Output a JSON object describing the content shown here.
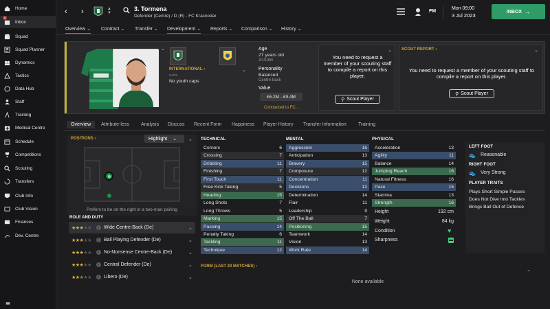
{
  "sidebar": {
    "items": [
      {
        "label": "Home",
        "icon": "home-icon"
      },
      {
        "label": "Inbox",
        "icon": "inbox-icon",
        "badge": "1"
      },
      {
        "label": "Squad",
        "icon": "squad-icon"
      },
      {
        "label": "Squad Planner",
        "icon": "planner-icon"
      },
      {
        "label": "Dynamics",
        "icon": "dynamics-icon"
      },
      {
        "label": "Tactics",
        "icon": "tactics-icon"
      },
      {
        "label": "Data Hub",
        "icon": "datahub-icon"
      },
      {
        "label": "Staff",
        "icon": "staff-icon"
      },
      {
        "label": "Training",
        "icon": "training-icon"
      },
      {
        "label": "Medical Centre",
        "icon": "medical-icon"
      },
      {
        "label": "Schedule",
        "icon": "schedule-icon"
      },
      {
        "label": "Competitions",
        "icon": "competitions-icon"
      },
      {
        "label": "Scouting",
        "icon": "scouting-icon"
      },
      {
        "label": "Transfers",
        "icon": "transfers-icon"
      },
      {
        "label": "Club Info",
        "icon": "clubinfo-icon"
      },
      {
        "label": "Club Vision",
        "icon": "clubvision-icon"
      },
      {
        "label": "Finances",
        "icon": "finances-icon"
      },
      {
        "label": "Dev. Centre",
        "icon": "devcentre-icon"
      }
    ]
  },
  "topbar": {
    "player_number_name": "3. Tormena",
    "player_subtitle": "Defender (Centre) / D (R) - FC Krasnodar",
    "day_time": "Mon 09:00",
    "date": "3 Jul 2023",
    "fm_label": "FM",
    "inbox_label": "INBOX"
  },
  "subnav": [
    "Overview",
    "Contract",
    "Transfer",
    "Development",
    "Reports",
    "Comparison",
    "History"
  ],
  "header": {
    "international_label": "INTERNATIONAL",
    "caps_label": "CAPS",
    "caps_value": "No youth caps",
    "age_label": "Age",
    "age_value": "27 years old",
    "dob": "4/1/1996",
    "personality_label": "Personality",
    "personality_value": "Balanced",
    "position_value": "Centre-back",
    "value_label": "Value",
    "value_range": "£6.2M - £9.4M",
    "contract_text": "Contracted to FC...",
    "scout_request_mid": "You need to request a member of your scouting staff to compile a report on this player.",
    "scout_button": "Scout Player",
    "scout_report_title": "SCOUT REPORT",
    "scout_request_right": "You need to request a member of your scouting staff to compile a report on this player.",
    "scout_button_right": "Scout Player"
  },
  "tabs": [
    "Overview",
    "Attribute-less",
    "Analysis",
    "Discuss",
    "Recent Form",
    "Happiness",
    "Player History",
    "Transfer Information",
    "Training"
  ],
  "positions": {
    "title": "POSITIONS",
    "highlight_label": "Highlight",
    "note": "Prefers to be on the right in a two-man pairing"
  },
  "roles": {
    "title": "ROLE AND DUTY",
    "items": [
      {
        "name": "Wide Centre-Back (De)",
        "stars": 3
      },
      {
        "name": "Ball Playing Defender (De)",
        "stars": 3
      },
      {
        "name": "No-Nonsense Centre-Back (De)",
        "stars": 3
      },
      {
        "name": "Central Defender (De)",
        "stars": 3
      },
      {
        "name": "Libero (De)",
        "stars": 2.5
      }
    ]
  },
  "technical": {
    "title": "TECHNICAL",
    "rows": [
      {
        "n": "Corners",
        "v": "6",
        "c": "none"
      },
      {
        "n": "Crossing",
        "v": "7",
        "c": "grey"
      },
      {
        "n": "Dribbling",
        "v": "11",
        "c": "blue"
      },
      {
        "n": "Finishing",
        "v": "7",
        "c": "grey"
      },
      {
        "n": "First Touch",
        "v": "11",
        "c": "blue"
      },
      {
        "n": "Free Kick Taking",
        "v": "5",
        "c": "grey"
      },
      {
        "n": "Heading",
        "v": "15",
        "c": "green"
      },
      {
        "n": "Long Shots",
        "v": "7",
        "c": "none"
      },
      {
        "n": "Long Throws",
        "v": "5",
        "c": "none"
      },
      {
        "n": "Marking",
        "v": "15",
        "c": "green"
      },
      {
        "n": "Passing",
        "v": "14",
        "c": "blue"
      },
      {
        "n": "Penalty Taking",
        "v": "6",
        "c": "none"
      },
      {
        "n": "Tackling",
        "v": "11",
        "c": "green"
      },
      {
        "n": "Technique",
        "v": "12",
        "c": "blue"
      }
    ]
  },
  "mental": {
    "title": "MENTAL",
    "rows": [
      {
        "n": "Aggression",
        "v": "16",
        "c": "blue"
      },
      {
        "n": "Anticipation",
        "v": "13",
        "c": "none"
      },
      {
        "n": "Bravery",
        "v": "15",
        "c": "blue"
      },
      {
        "n": "Composure",
        "v": "12",
        "c": "grey"
      },
      {
        "n": "Concentration",
        "v": "11",
        "c": "blue"
      },
      {
        "n": "Decisions",
        "v": "12",
        "c": "blue"
      },
      {
        "n": "Determination",
        "v": "14",
        "c": "none"
      },
      {
        "n": "Flair",
        "v": "11",
        "c": "none"
      },
      {
        "n": "Leadership",
        "v": "9",
        "c": "none"
      },
      {
        "n": "Off The Ball",
        "v": "7",
        "c": "grey"
      },
      {
        "n": "Positioning",
        "v": "15",
        "c": "green"
      },
      {
        "n": "Teamwork",
        "v": "14",
        "c": "none"
      },
      {
        "n": "Vision",
        "v": "13",
        "c": "none"
      },
      {
        "n": "Work Rate",
        "v": "14",
        "c": "blue"
      }
    ]
  },
  "physical": {
    "title": "PHYSICAL",
    "rows": [
      {
        "n": "Acceleration",
        "v": "13",
        "c": "none"
      },
      {
        "n": "Agility",
        "v": "11",
        "c": "blue"
      },
      {
        "n": "Balance",
        "v": "14",
        "c": "none"
      },
      {
        "n": "Jumping Reach",
        "v": "16",
        "c": "green"
      },
      {
        "n": "Natural Fitness",
        "v": "16",
        "c": "none"
      },
      {
        "n": "Pace",
        "v": "15",
        "c": "blue"
      },
      {
        "n": "Stamina",
        "v": "13",
        "c": "none"
      },
      {
        "n": "Strength",
        "v": "16",
        "c": "green"
      }
    ],
    "height_label": "Height",
    "height_value": "192 cm",
    "weight_label": "Weight",
    "weight_value": "84 kg",
    "condition_label": "Condition",
    "sharpness_label": "Sharpness"
  },
  "right": {
    "left_foot_label": "LEFT FOOT",
    "left_foot_value": "Reasonable",
    "right_foot_label": "RIGHT FOOT",
    "right_foot_value": "Very Strong",
    "traits_title": "PLAYER TRAITS",
    "traits": [
      "Plays Short Simple Passes",
      "Does Not Dive Into Tackles",
      "Brings Ball Out of Defence"
    ]
  },
  "form": {
    "title": "FORM (LAST 20 MATCHES)",
    "empty": "None available"
  },
  "colors": {
    "accent_green": "#33b878",
    "blue_row": "#3a4d6a",
    "green_row": "#3c6a4f",
    "gold": "#d4a53a"
  }
}
